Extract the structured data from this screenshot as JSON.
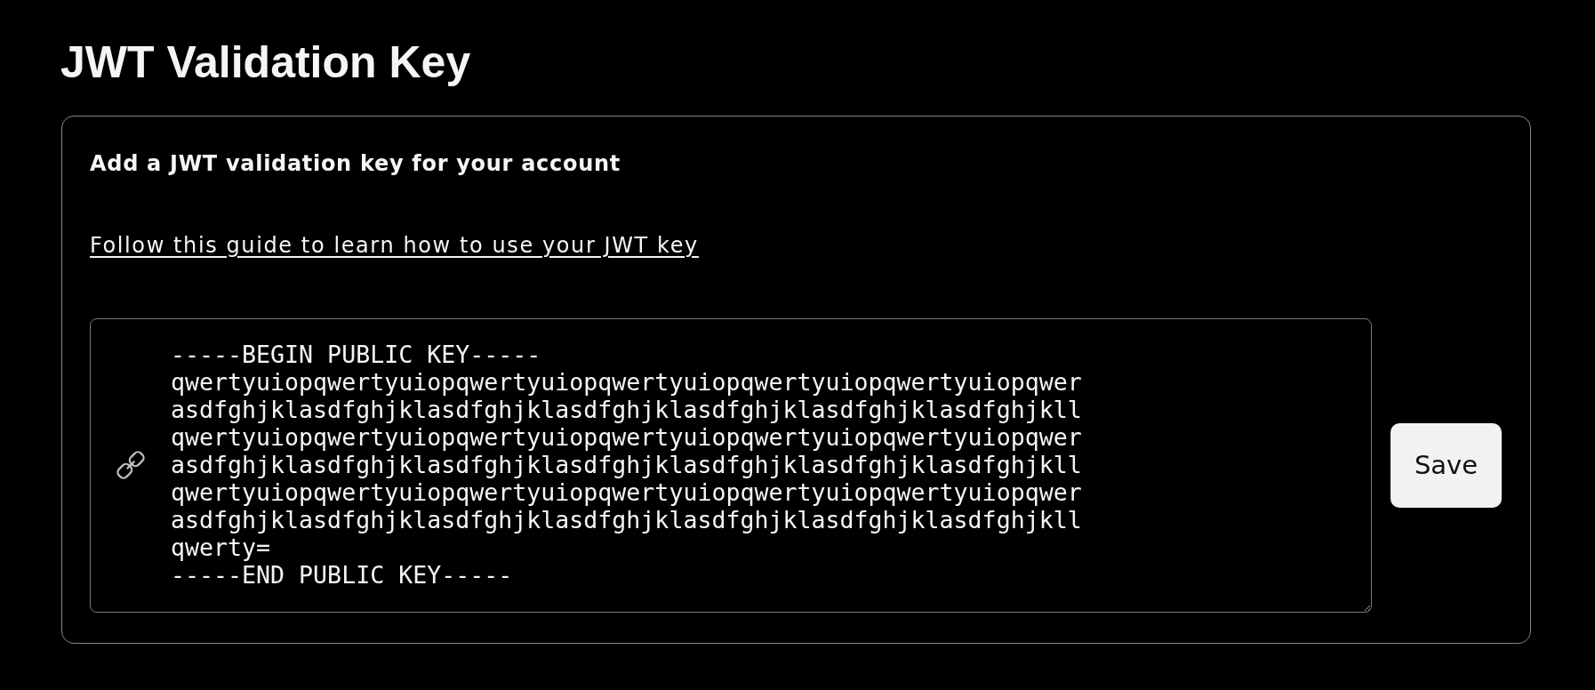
{
  "page": {
    "title": "JWT Validation Key"
  },
  "card": {
    "heading": "Add a JWT validation key for your account",
    "guide_link": "Follow this guide to learn how to use your JWT key",
    "key_field": {
      "value": "-----BEGIN PUBLIC KEY-----\nqwertyuiopqwertyuiopqwertyuiopqwertyuiopqwertyuiopqwertyuiopqwer\nasdfghjklasdfghjklasdfghjklasdfghjklasdfghjklasdfghjklasdfghjkll\nqwertyuiopqwertyuiopqwertyuiopqwertyuiopqwertyuiopqwertyuiopqwer\nasdfghjklasdfghjklasdfghjklasdfghjklasdfghjklasdfghjklasdfghjkll\nqwertyuiopqwertyuiopqwertyuiopqwertyuiopqwertyuiopqwertyuiopqwer\nasdfghjklasdfghjklasdfghjklasdfghjklasdfghjklasdfghjklasdfghjkll\nqwerty=\n-----END PUBLIC KEY-----"
    },
    "save_button": "Save"
  }
}
